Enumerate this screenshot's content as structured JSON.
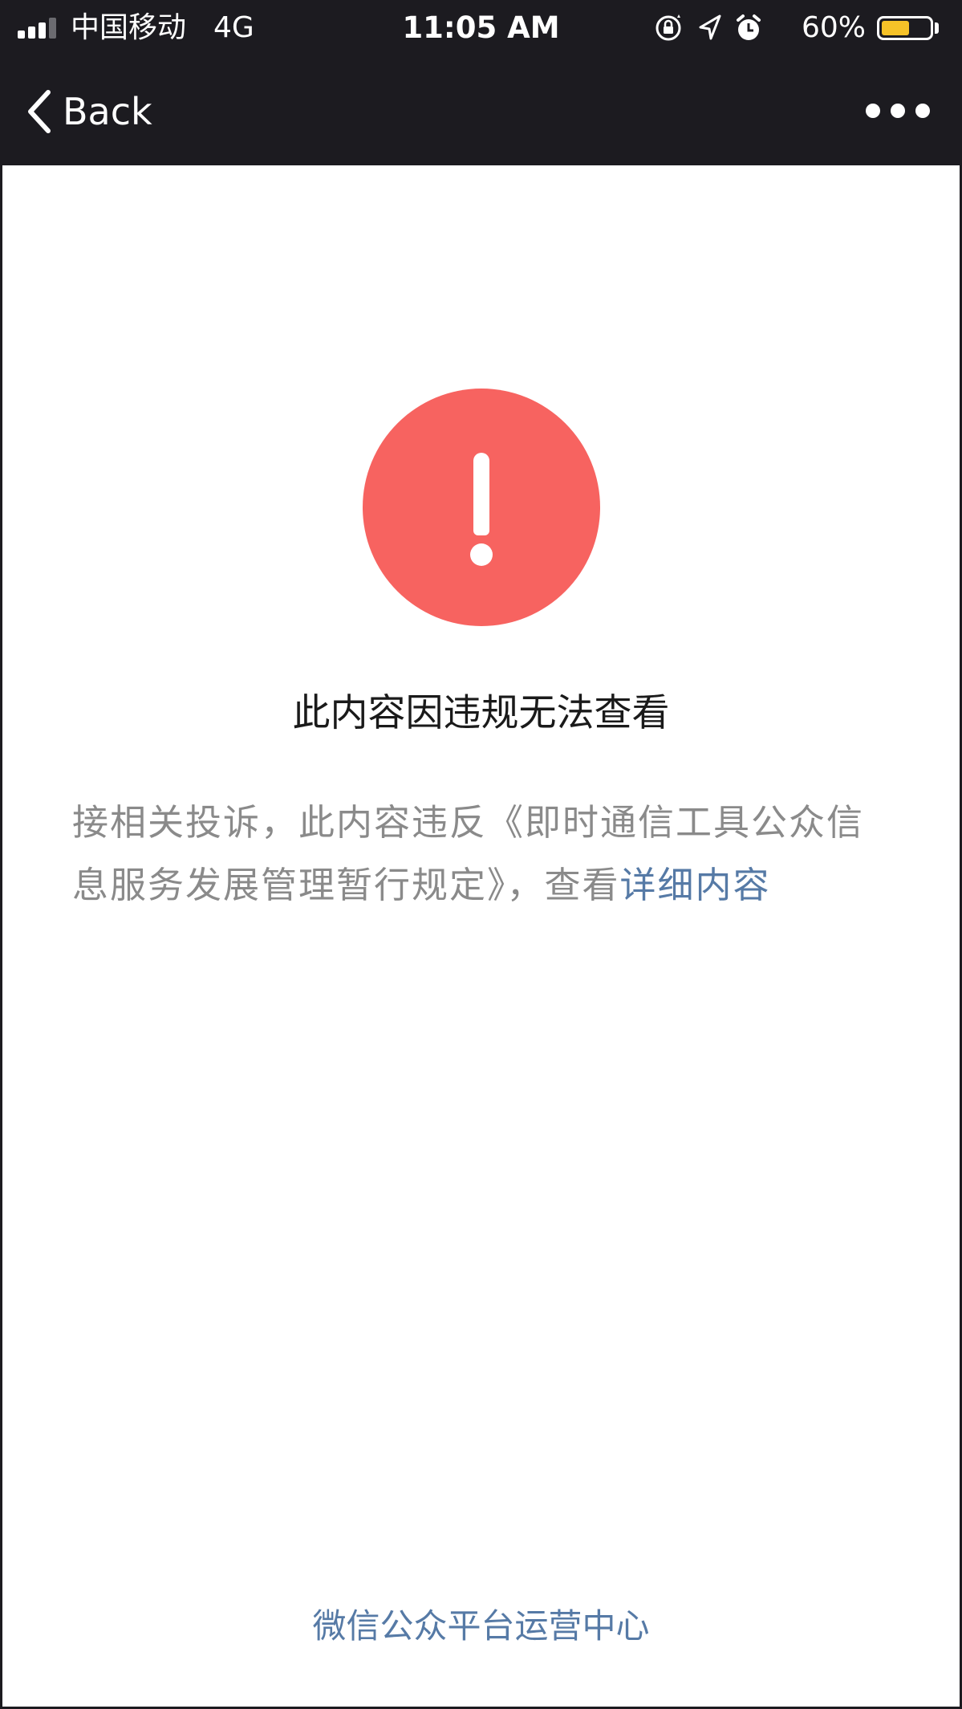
{
  "status_bar": {
    "carrier": "中国移动",
    "network": "4G",
    "time": "11:05 AM",
    "battery_percent": "60%",
    "icons": [
      "signal-icon",
      "orientation-lock-icon",
      "location-arrow-icon",
      "alarm-icon",
      "battery-icon"
    ],
    "battery_level": 0.6,
    "battery_color": "#f6c228"
  },
  "nav": {
    "back_label": "Back",
    "icons": [
      "chevron-left-icon",
      "more-icon"
    ]
  },
  "main": {
    "icon": "exclamation-circle-icon",
    "icon_color": "#f76360",
    "title": "此内容因违规无法查看",
    "description_prefix": "接相关投诉，此内容违反《即时通信工具公众信息服务发展管理暂行规定》，查看",
    "description_link": "详细内容",
    "text_color": "#8a8a8a",
    "link_color": "#567aa6"
  },
  "footer": {
    "label": "微信公众平台运营中心"
  },
  "theme": {
    "bar_background": "#1c1b20",
    "page_background": "#ffffff"
  }
}
